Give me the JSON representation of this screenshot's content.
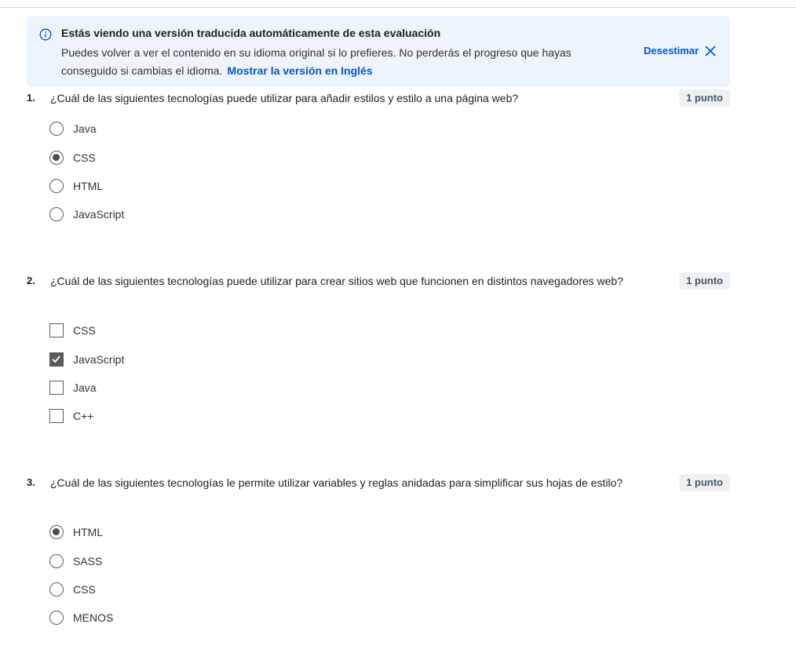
{
  "banner": {
    "title": "Estás viendo una versión traducida automáticamente de esta evaluación",
    "body": "Puedes volver a ver el contenido en su idioma original si lo prefieres. No perderás el progreso que hayas conseguido si cambias el idioma.",
    "link": "Mostrar la versión en Inglés",
    "dismiss": "Desestimar"
  },
  "questions": [
    {
      "number": "1.",
      "text": "¿Cuál de las siguientes tecnologías puede utilizar para añadir estilos y estilo a una página web?",
      "points": "1 punto",
      "type": "radio",
      "options": [
        {
          "label": "Java",
          "selected": false
        },
        {
          "label": "CSS",
          "selected": true
        },
        {
          "label": "HTML",
          "selected": false
        },
        {
          "label": "JavaScript",
          "selected": false
        }
      ]
    },
    {
      "number": "2.",
      "text": "¿Cuál de las siguientes tecnologías puede utilizar para crear sitios web que funcionen en distintos navegadores web?",
      "points": "1 punto",
      "type": "checkbox",
      "options": [
        {
          "label": "CSS",
          "selected": false
        },
        {
          "label": "JavaScript",
          "selected": true
        },
        {
          "label": "Java",
          "selected": false
        },
        {
          "label": "C++",
          "selected": false
        }
      ]
    },
    {
      "number": "3.",
      "text": "¿Cuál de las siguientes tecnologías le permite utilizar variables y reglas anidadas para simplificar sus hojas de estilo?",
      "points": "1 punto",
      "type": "radio",
      "options": [
        {
          "label": "HTML",
          "selected": true
        },
        {
          "label": "SASS",
          "selected": false
        },
        {
          "label": "CSS",
          "selected": false
        },
        {
          "label": "MENOS",
          "selected": false
        }
      ]
    }
  ]
}
